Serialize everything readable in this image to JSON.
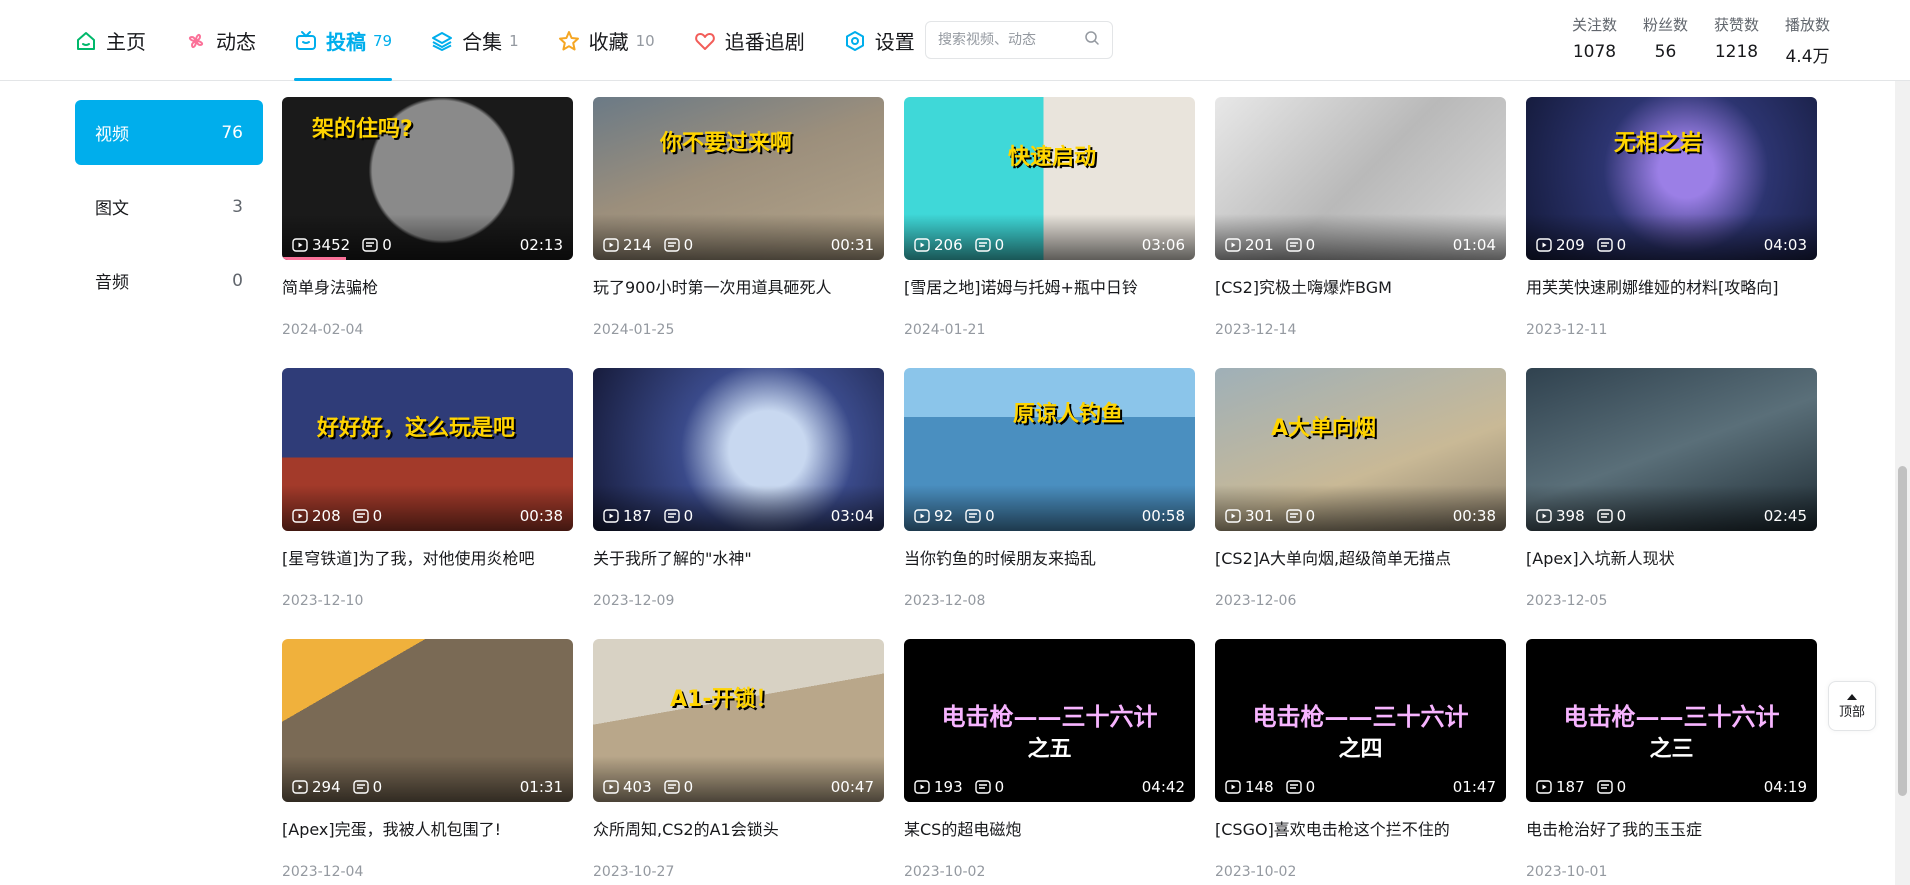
{
  "nav": {
    "items": [
      {
        "label": "主页",
        "count": "",
        "icon": "home-icon",
        "active": false
      },
      {
        "label": "动态",
        "count": "",
        "icon": "pinwheel-icon",
        "active": false
      },
      {
        "label": "投稿",
        "count": "79",
        "icon": "tv-icon",
        "active": true
      },
      {
        "label": "合集",
        "count": "1",
        "icon": "layers-icon",
        "active": false
      },
      {
        "label": "收藏",
        "count": "10",
        "icon": "star-icon",
        "active": false
      },
      {
        "label": "追番追剧",
        "count": "",
        "icon": "heart-icon",
        "active": false
      },
      {
        "label": "设置",
        "count": "",
        "icon": "gear-icon",
        "active": false
      }
    ],
    "search_placeholder": "搜索视频、动态"
  },
  "stats": [
    {
      "label": "关注数",
      "value": "1078"
    },
    {
      "label": "粉丝数",
      "value": "56"
    },
    {
      "label": "获赞数",
      "value": "1218"
    },
    {
      "label": "播放数",
      "value": "4.4万"
    }
  ],
  "sidebar": [
    {
      "label": "视频",
      "count": "76",
      "active": true
    },
    {
      "label": "图文",
      "count": "3",
      "active": false
    },
    {
      "label": "音频",
      "count": "0",
      "active": false
    }
  ],
  "videos": [
    {
      "title": "简单身法骗枪",
      "date": "2024-02-04",
      "views": "3452",
      "danmaku": "0",
      "duration": "02:13",
      "overlay": "架的住吗?",
      "watched": 0.22
    },
    {
      "title": "玩了900小时第一次用道具砸死人",
      "date": "2024-01-25",
      "views": "214",
      "danmaku": "0",
      "duration": "00:31",
      "overlay": "你不要过来啊"
    },
    {
      "title": "[雪居之地]诺姆与托姆+瓶中日铃",
      "date": "2024-01-21",
      "views": "206",
      "danmaku": "0",
      "duration": "03:06",
      "overlay": "快速启动"
    },
    {
      "title": "[CS2]究极土嗨爆炸BGM",
      "date": "2023-12-14",
      "views": "201",
      "danmaku": "0",
      "duration": "01:04",
      "overlay": ""
    },
    {
      "title": "用芙芙快速刷娜维娅的材料[攻略向]",
      "date": "2023-12-11",
      "views": "209",
      "danmaku": "0",
      "duration": "04:03",
      "overlay": "无相之岩"
    },
    {
      "title": "[星穹铁道]为了我，对他使用炎枪吧",
      "date": "2023-12-10",
      "views": "208",
      "danmaku": "0",
      "duration": "00:38",
      "overlay": "好好好，这么玩是吧"
    },
    {
      "title": "关于我所了解的\"水神\"",
      "date": "2023-12-09",
      "views": "187",
      "danmaku": "0",
      "duration": "03:04",
      "overlay": ""
    },
    {
      "title": "当你钓鱼的时候朋友来捣乱",
      "date": "2023-12-08",
      "views": "92",
      "danmaku": "0",
      "duration": "00:58",
      "overlay": "原谅人钓鱼"
    },
    {
      "title": "[CS2]A大单向烟,超级简单无描点",
      "date": "2023-12-06",
      "views": "301",
      "danmaku": "0",
      "duration": "00:38",
      "overlay": "A大单向烟"
    },
    {
      "title": "[Apex]入坑新人现状",
      "date": "2023-12-05",
      "views": "398",
      "danmaku": "0",
      "duration": "02:45",
      "overlay": ""
    },
    {
      "title": "[Apex]完蛋，我被人机包围了!",
      "date": "2023-12-04",
      "views": "294",
      "danmaku": "0",
      "duration": "01:31",
      "overlay": ""
    },
    {
      "title": "众所周知,CS2的A1会锁头",
      "date": "2023-10-27",
      "views": "403",
      "danmaku": "0",
      "duration": "00:47",
      "overlay": "A1-开锁！"
    },
    {
      "title": "某CS的超电磁炮",
      "date": "2023-10-02",
      "views": "193",
      "danmaku": "0",
      "duration": "04:42",
      "overlay": "电击枪——三十六计",
      "sub": "之五"
    },
    {
      "title": "[CSGO]喜欢电击枪这个拦不住的",
      "date": "2023-10-02",
      "views": "148",
      "danmaku": "0",
      "duration": "01:47",
      "overlay": "电击枪——三十六计",
      "sub": "之四"
    },
    {
      "title": "电击枪治好了我的玉玉症",
      "date": "2023-10-01",
      "views": "187",
      "danmaku": "0",
      "duration": "04:19",
      "overlay": "电击枪——三十六计",
      "sub": "之三"
    }
  ],
  "back_to_top": "顶部",
  "colors": {
    "accent": "#00aeec",
    "progress": "#fb7299"
  }
}
